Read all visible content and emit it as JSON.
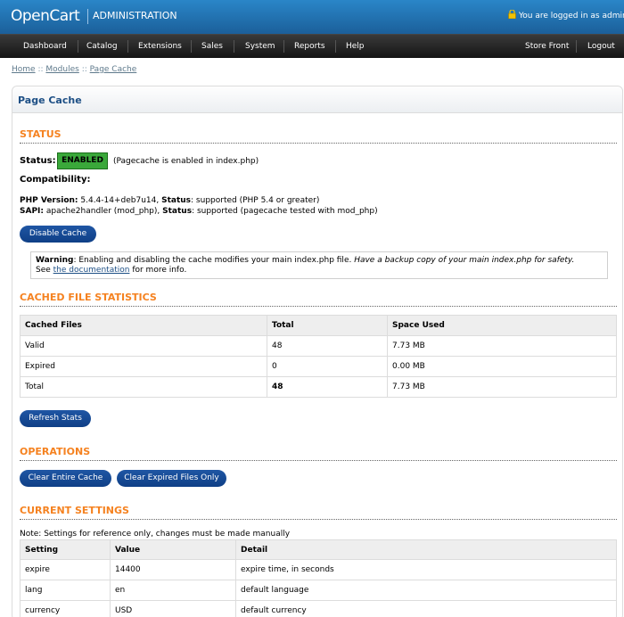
{
  "header": {
    "logo": "OpenCart",
    "subtitle": "ADMINISTRATION",
    "login_text": "You are logged in as admin"
  },
  "nav": {
    "items": [
      "Dashboard",
      "Catalog",
      "Extensions",
      "Sales",
      "System",
      "Reports",
      "Help"
    ],
    "right_items": [
      "Store Front",
      "Logout"
    ]
  },
  "breadcrumb": {
    "home": "Home",
    "sep1": "::",
    "modules": "Modules",
    "sep2": "::",
    "current": "Page Cache"
  },
  "page": {
    "title": "Page Cache"
  },
  "status": {
    "heading": "STATUS",
    "label": "Status:",
    "badge": "ENABLED",
    "badge_color": "#3aa83a",
    "note": "(Pagecache is enabled in index.php)",
    "compat_label": "Compatibility:",
    "php_label": "PHP Version:",
    "php_value": " 5.4.4-14+deb7u14, ",
    "php_status_label": "Status",
    "php_status": ": supported (PHP 5.4 or greater)",
    "sapi_label": "SAPI:",
    "sapi_value": " apache2handler (mod_php), ",
    "sapi_status_label": "Status",
    "sapi_status": ": supported (pagecache tested with mod_php)",
    "disable_button": "Disable Cache"
  },
  "warning": {
    "label": "Warning",
    "text": ": Enabling and disabling the cache modifies your main index.php file. ",
    "italic": "Have a backup copy of your main index.php for safety.",
    "see": "See ",
    "link": "the documentation",
    "more": " for more info."
  },
  "stats": {
    "heading": "CACHED FILE STATISTICS",
    "columns": [
      "Cached Files",
      "Total",
      "Space Used"
    ],
    "rows": [
      [
        "Valid",
        "48",
        "7.73 MB"
      ],
      [
        "Expired",
        "0",
        "0.00 MB"
      ],
      [
        "Total",
        "48",
        "7.73 MB"
      ]
    ],
    "refresh_button": "Refresh Stats"
  },
  "operations": {
    "heading": "OPERATIONS",
    "clear_all_button": "Clear Entire Cache",
    "clear_expired_button": "Clear Expired Files Only"
  },
  "settings": {
    "heading": "CURRENT SETTINGS",
    "note": "Note: Settings for reference only, changes must be made manually",
    "columns": [
      "Setting",
      "Value",
      "Detail"
    ],
    "rows": [
      [
        "expire",
        "14400",
        "expire time, in seconds"
      ],
      [
        "lang",
        "en",
        "default language"
      ],
      [
        "currency",
        "USD",
        "default currency"
      ]
    ]
  },
  "colors": {
    "header_blue": "#1b5f9a",
    "section_orange": "#f58220",
    "button_blue": "#0f3f86",
    "title_blue": "#1d4f85"
  }
}
